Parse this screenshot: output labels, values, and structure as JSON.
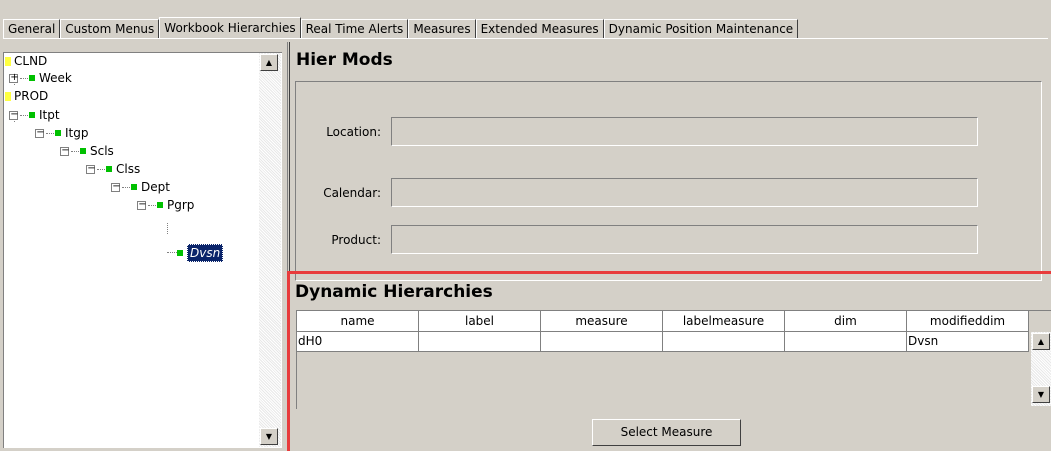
{
  "tabs": [
    {
      "label": "General"
    },
    {
      "label": "Custom Menus"
    },
    {
      "label": "Workbook Hierarchies"
    },
    {
      "label": "Real Time Alerts"
    },
    {
      "label": "Measures"
    },
    {
      "label": "Extended Measures"
    },
    {
      "label": "Dynamic Position Maintenance"
    }
  ],
  "active_tab": "Workbook Hierarchies",
  "tree": {
    "nodes": [
      {
        "label": "CLND",
        "level": 0
      },
      {
        "label": "Week",
        "level": 1,
        "expander": "+"
      },
      {
        "label": "PROD",
        "level": 0
      },
      {
        "label": "Itpt",
        "level": 1,
        "expander": "−"
      },
      {
        "label": "Itgp",
        "level": 2,
        "expander": "−"
      },
      {
        "label": "Scls",
        "level": 3,
        "expander": "−"
      },
      {
        "label": "Clss",
        "level": 4,
        "expander": "−"
      },
      {
        "label": "Dept",
        "level": 5,
        "expander": "−"
      },
      {
        "label": "Pgrp",
        "level": 6,
        "expander": "−"
      },
      {
        "label": "Dvsn",
        "level": 7,
        "selected": true
      }
    ]
  },
  "hier_mods": {
    "title": "Hier Mods",
    "location_label": "Location:",
    "location_value": "",
    "calendar_label": "Calendar:",
    "calendar_value": "",
    "product_label": "Product:",
    "product_value": ""
  },
  "dynamic_hierarchies": {
    "title": "Dynamic Hierarchies",
    "columns": [
      "name",
      "label",
      "measure",
      "labelmeasure",
      "dim",
      "modifieddim"
    ],
    "rows": [
      [
        "dH0",
        "",
        "",
        "",
        "",
        "Dvsn"
      ]
    ],
    "select_button_label": "Select Measure"
  },
  "colors": {
    "window_bg": "#d4d0c8",
    "highlight_frame": "#e83b3b",
    "selection_bg": "#0a246a",
    "node_green": "#00c000",
    "node_yellow": "#ffff40"
  }
}
